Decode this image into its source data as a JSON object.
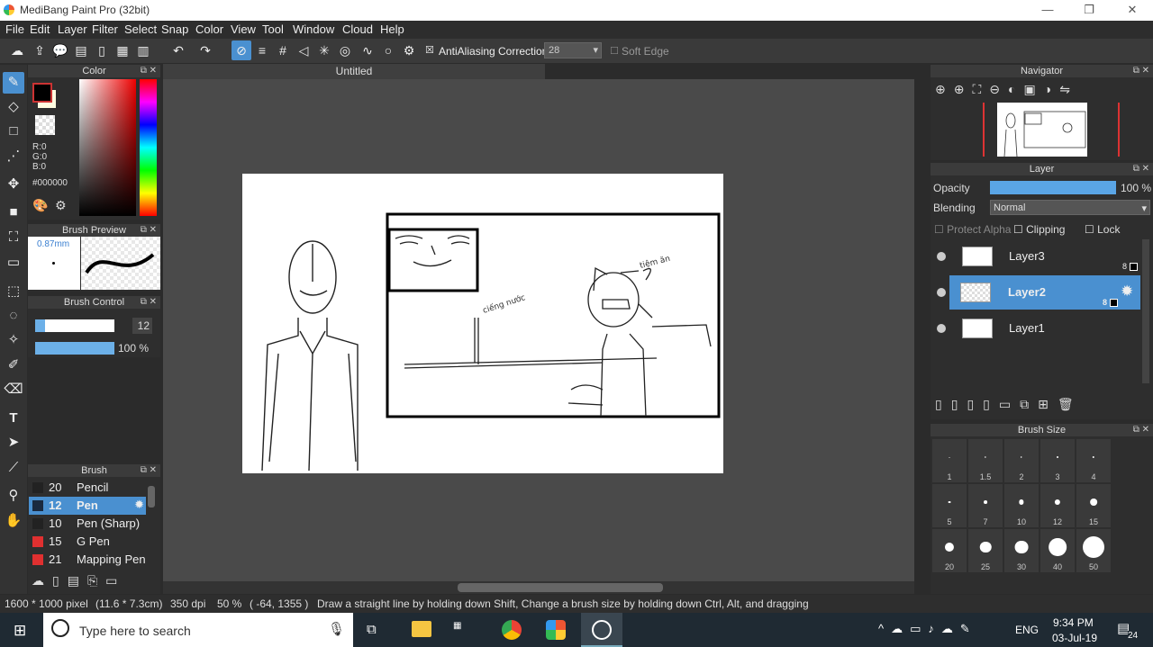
{
  "window": {
    "title": "MediBang Paint Pro (32bit)"
  },
  "menu": [
    "File",
    "Edit",
    "Layer",
    "Filter",
    "Select",
    "Snap",
    "Color",
    "View",
    "Tool",
    "Window",
    "Cloud",
    "Help"
  ],
  "toolbar": {
    "antialias_label": "AntiAliasing",
    "correction_label": "Correction",
    "correction_value": "28",
    "soft_edge_label": "Soft Edge"
  },
  "document": {
    "tab": "Untitled"
  },
  "color_panel": {
    "title": "Color",
    "r": "R:0",
    "g": "G:0",
    "b": "B:0",
    "hex": "#000000",
    "fg": "#000000",
    "bg": "#fffce0"
  },
  "brush_preview": {
    "title": "Brush Preview",
    "size": "0.87mm"
  },
  "brush_control": {
    "title": "Brush Control",
    "size": "12",
    "opacity": "100 %",
    "size_level": 0.12,
    "opacity_level": 1.0
  },
  "brush_panel": {
    "title": "Brush",
    "items": [
      {
        "size": "20",
        "name": "Pencil",
        "color": "#222222"
      },
      {
        "size": "12",
        "name": "Pen",
        "color": "#1a2a40",
        "selected": true
      },
      {
        "size": "10",
        "name": "Pen (Sharp)",
        "color": "#222222"
      },
      {
        "size": "15",
        "name": "G Pen",
        "color": "#e03030"
      },
      {
        "size": "21",
        "name": "Mapping Pen",
        "color": "#e03030"
      }
    ]
  },
  "navigator": {
    "title": "Navigator"
  },
  "layer_panel": {
    "title": "Layer",
    "opacity_label": "Opacity",
    "opacity_value": "100 %",
    "opacity_level": 1.0,
    "blending_label": "Blending",
    "blending_value": "Normal",
    "protect_alpha": "Protect Alpha",
    "clipping": "Clipping",
    "lock": "Lock",
    "layers": [
      {
        "name": "Layer3",
        "badge": "8"
      },
      {
        "name": "Layer2",
        "badge": "8",
        "selected": true
      },
      {
        "name": "Layer1",
        "badge": ""
      }
    ]
  },
  "brush_size": {
    "title": "Brush Size",
    "sizes": [
      "1",
      "1.5",
      "2",
      "3",
      "4",
      "5",
      "7",
      "10",
      "12",
      "15",
      "20",
      "25",
      "30",
      "40",
      "50"
    ]
  },
  "status": {
    "dimensions": "1600 * 1000 pixel",
    "physical": "(11.6 * 7.3cm)",
    "dpi": "350 dpi",
    "zoom": "50 %",
    "coords": "( -64, 1355 )",
    "hint": "Draw a straight line by holding down Shift, Change a brush size by holding down Ctrl, Alt, and dragging"
  },
  "taskbar": {
    "search_placeholder": "Type here to search",
    "lang": "ENG",
    "time": "9:34 PM",
    "date": "03-Jul-19",
    "notifications": "24"
  },
  "canvas_text": {
    "note1": "ciếng nước",
    "note2": "tiệm ăn"
  }
}
